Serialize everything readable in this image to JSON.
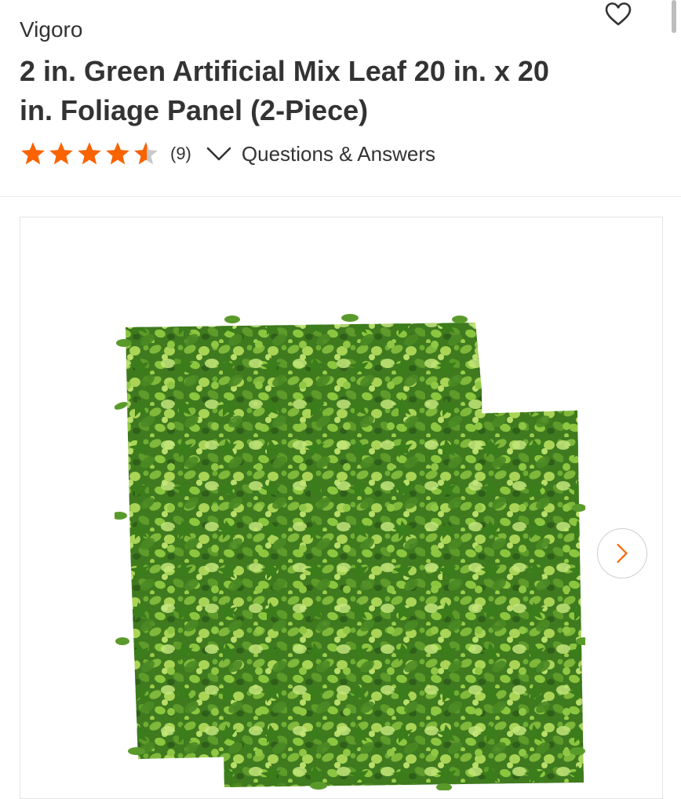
{
  "product": {
    "brand": "Vigoro",
    "title": "2 in. Green Artificial Mix Leaf 20 in. x 20 in. Foliage Panel (2-Piece)"
  },
  "rating": {
    "value": 4.5,
    "max": 5,
    "count_label": "(9)",
    "star_color": "#f96302"
  },
  "qa": {
    "label": "Questions & Answers",
    "icon": "chevron-down-icon"
  },
  "actions": {
    "favorite_icon": "heart-icon"
  },
  "gallery": {
    "next_icon": "chevron-right-icon",
    "accent": "#f96302",
    "image_subject": "foliage panel"
  }
}
